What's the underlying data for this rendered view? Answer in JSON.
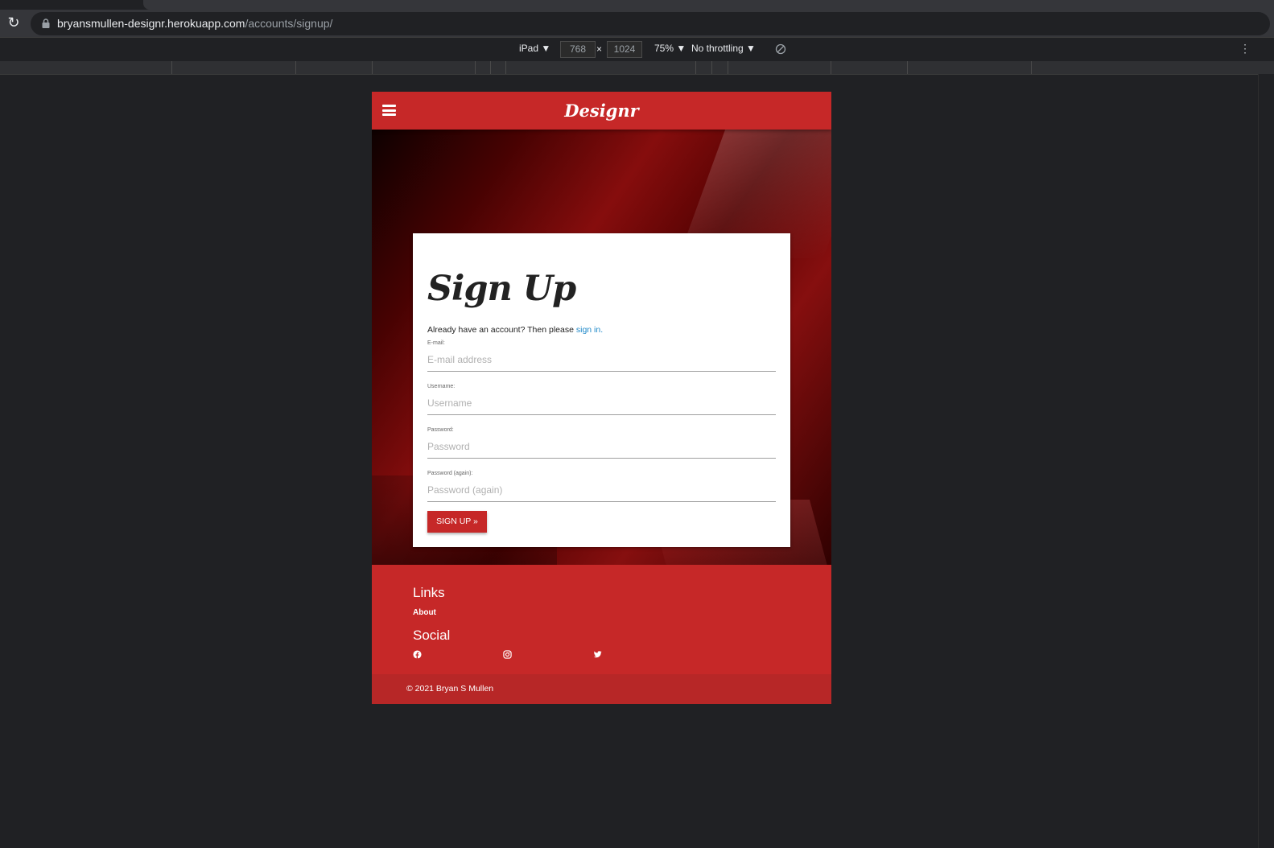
{
  "browser": {
    "url_host": "bryansmullen-designr.herokuapp.com",
    "url_path": "/accounts/signup/"
  },
  "devtools": {
    "device": "iPad ▼",
    "width": "768",
    "times": "×",
    "height": "1024",
    "zoom": "75% ▼",
    "throttling": "No throttling ▼"
  },
  "nav": {
    "brand": "Designr"
  },
  "signup": {
    "title": "Sign Up",
    "already_text": "Already have an account? Then please ",
    "signin_link": "sign in.",
    "fields": [
      {
        "label": "E-mail:",
        "placeholder": "E-mail address"
      },
      {
        "label": "Username:",
        "placeholder": "Username"
      },
      {
        "label": "Password:",
        "placeholder": "Password"
      },
      {
        "label": "Password (again):",
        "placeholder": "Password (again)"
      }
    ],
    "button": "SIGN UP »"
  },
  "footer": {
    "links_heading": "Links",
    "about": "About",
    "social_heading": "Social",
    "social_icons": [
      "facebook-icon",
      "instagram-icon",
      "twitter-icon"
    ],
    "copyright": "© 2021 Bryan S Mullen"
  },
  "colors": {
    "brand_red": "#c62828",
    "link_blue": "#1e88c8"
  }
}
